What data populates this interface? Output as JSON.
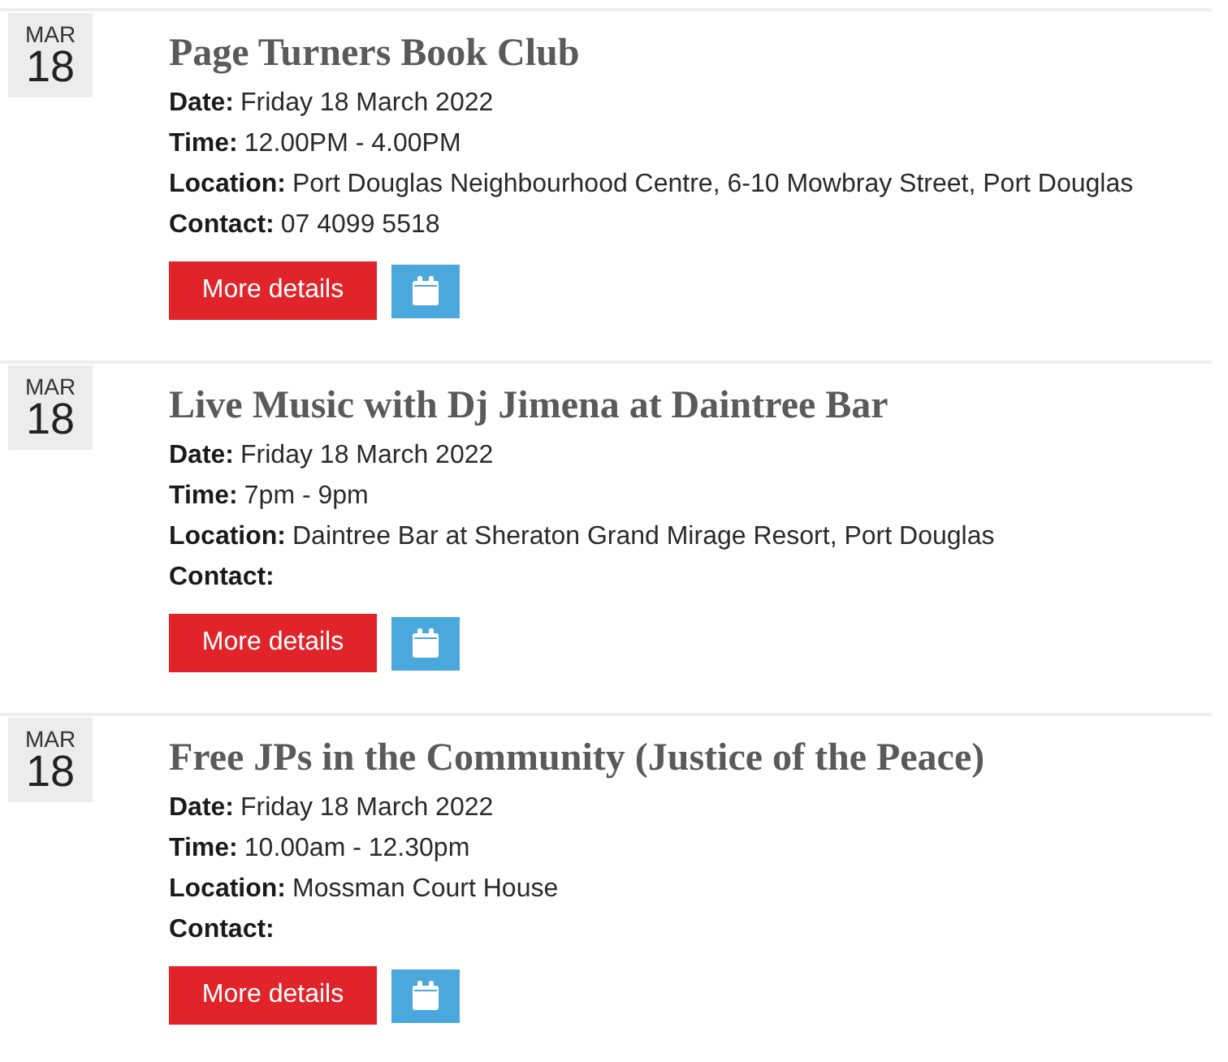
{
  "events": [
    {
      "month": "MAR",
      "day": "18",
      "title": "Page Turners Book Club",
      "fields": [
        {
          "label": "Date:",
          "value": "Friday 18 March 2022"
        },
        {
          "label": "Time:",
          "value": "12.00PM - 4.00PM"
        },
        {
          "label": "Location:",
          "value": "Port Douglas Neighbourhood Centre, 6-10 Mowbray Street, Port Douglas"
        },
        {
          "label": "Contact:",
          "value": "07 4099 5518"
        }
      ],
      "details_button": "More details"
    },
    {
      "month": "MAR",
      "day": "18",
      "title": "Live Music with Dj Jimena at Daintree Bar",
      "fields": [
        {
          "label": "Date:",
          "value": "Friday 18 March 2022"
        },
        {
          "label": "Time:",
          "value": "7pm - 9pm"
        },
        {
          "label": "Location:",
          "value": "Daintree Bar at Sheraton Grand Mirage Resort, Port Douglas"
        },
        {
          "label": "Contact:"
        }
      ],
      "details_button": "More details"
    },
    {
      "month": "MAR",
      "day": "18",
      "title": "Free JPs in the Community (Justice of the Peace)",
      "fields": [
        {
          "label": "Date:",
          "value": "Friday 18 March 2022"
        },
        {
          "label": "Time:",
          "value": "10.00am - 12.30pm"
        },
        {
          "label": "Location:",
          "value": "Mossman Court House"
        },
        {
          "label": "Contact:"
        }
      ],
      "details_button": "More details"
    }
  ]
}
